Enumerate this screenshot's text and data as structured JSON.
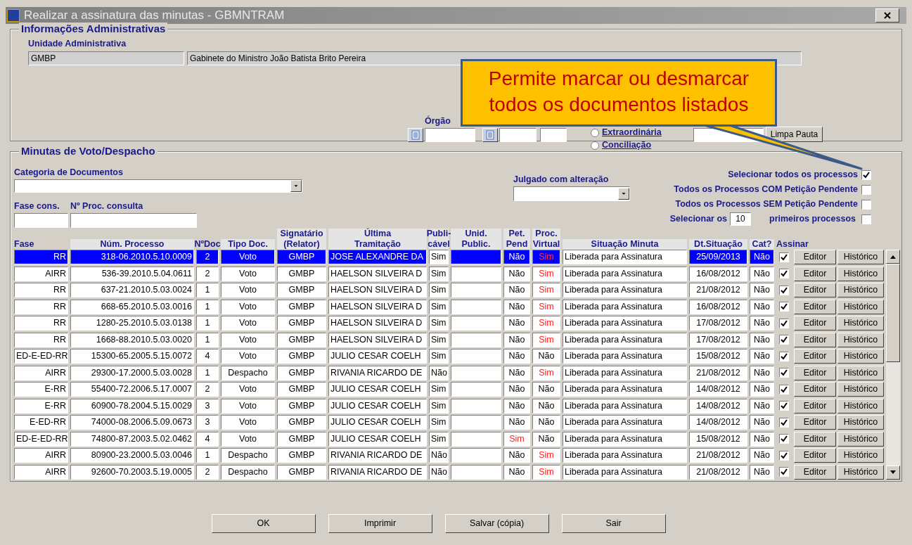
{
  "window": {
    "title": "Realizar a assinatura das minutas - GBMNTRAM"
  },
  "admin": {
    "title": "Informações Administrativas",
    "unit_label": "Unidade Administrativa",
    "unit_code": "GMBP",
    "unit_name": "Gabinete do Ministro João Batista Brito Pereira",
    "orgao_label": "Órgão",
    "sessions": [
      {
        "label": "Extraordinária",
        "selected": false
      },
      {
        "label": "Conciliação",
        "selected": false
      }
    ],
    "clear_button": "Limpa Pauta"
  },
  "minutas": {
    "title": "Minutas de Voto/Despacho",
    "category_label": "Categoria de Documentos",
    "phase_label": "Fase cons.",
    "proc_label": "Nº Proc. consulta",
    "judged_label": "Julgado com alteração",
    "options": [
      {
        "label": "Selecionar todos os processos",
        "checked": true
      },
      {
        "label": "Todos os Processos COM Petição Pendente",
        "checked": false
      },
      {
        "label": "Todos os Processos SEM Petição Pendente",
        "checked": false
      }
    ],
    "select_first": {
      "prefix": "Selecionar os",
      "value": "10",
      "suffix": "primeiros processos",
      "checked": false
    },
    "columns": [
      [
        "Fase"
      ],
      [
        "Núm. Processo"
      ],
      [
        "NºDoc"
      ],
      [
        "Tipo Doc."
      ],
      [
        "Signatário",
        "(Relator)"
      ],
      [
        "Última",
        "Tramitação"
      ],
      [
        "Publi-",
        "cável"
      ],
      [
        "Unid.",
        "Public."
      ],
      [
        "Pet.",
        "Pend"
      ],
      [
        "Proc.",
        "Virtual"
      ],
      [
        "Situação Minuta"
      ],
      [
        "Dt.Situação"
      ],
      [
        "Cat?"
      ],
      [
        "Assinar"
      ]
    ],
    "rows": [
      {
        "selected": true,
        "phase": "RR",
        "process": "318-06.2010.5.10.0009",
        "doc": "2",
        "type": "Voto",
        "signer": "GMBP",
        "last": "JOSE ALEXANDRE DA",
        "publishable": "Sim",
        "pet": {
          "text": "Não",
          "alert": false
        },
        "virtual": {
          "text": "Sim",
          "alert": true
        },
        "status": "Liberada para Assinatura",
        "date": "25/09/2013",
        "cat": "Não",
        "sign": true,
        "editor": "Editor",
        "history": "Histórico"
      },
      {
        "selected": false,
        "phase": "AIRR",
        "process": "536-39.2010.5.04.0611",
        "doc": "2",
        "type": "Voto",
        "signer": "GMBP",
        "last": "HAELSON SILVEIRA D",
        "publishable": "Sim",
        "pet": {
          "text": "Não",
          "alert": false
        },
        "virtual": {
          "text": "Sim",
          "alert": true
        },
        "status": "Liberada para Assinatura",
        "date": "16/08/2012",
        "cat": "Não",
        "sign": true,
        "editor": "Editor",
        "history": "Histórico"
      },
      {
        "selected": false,
        "phase": "RR",
        "process": "637-21.2010.5.03.0024",
        "doc": "1",
        "type": "Voto",
        "signer": "GMBP",
        "last": "HAELSON SILVEIRA D",
        "publishable": "Sim",
        "pet": {
          "text": "Não",
          "alert": false
        },
        "virtual": {
          "text": "Sim",
          "alert": true
        },
        "status": "Liberada para Assinatura",
        "date": "21/08/2012",
        "cat": "Não",
        "sign": true,
        "editor": "Editor",
        "history": "Histórico"
      },
      {
        "selected": false,
        "phase": "RR",
        "process": "668-65.2010.5.03.0016",
        "doc": "1",
        "type": "Voto",
        "signer": "GMBP",
        "last": "HAELSON SILVEIRA D",
        "publishable": "Sim",
        "pet": {
          "text": "Não",
          "alert": false
        },
        "virtual": {
          "text": "Sim",
          "alert": true
        },
        "status": "Liberada para Assinatura",
        "date": "16/08/2012",
        "cat": "Não",
        "sign": true,
        "editor": "Editor",
        "history": "Histórico"
      },
      {
        "selected": false,
        "phase": "RR",
        "process": "1280-25.2010.5.03.0138",
        "doc": "1",
        "type": "Voto",
        "signer": "GMBP",
        "last": "HAELSON SILVEIRA D",
        "publishable": "Sim",
        "pet": {
          "text": "Não",
          "alert": false
        },
        "virtual": {
          "text": "Sim",
          "alert": true
        },
        "status": "Liberada para Assinatura",
        "date": "17/08/2012",
        "cat": "Não",
        "sign": true,
        "editor": "Editor",
        "history": "Histórico"
      },
      {
        "selected": false,
        "phase": "RR",
        "process": "1668-88.2010.5.03.0020",
        "doc": "1",
        "type": "Voto",
        "signer": "GMBP",
        "last": "HAELSON SILVEIRA D",
        "publishable": "Sim",
        "pet": {
          "text": "Não",
          "alert": false
        },
        "virtual": {
          "text": "Sim",
          "alert": true
        },
        "status": "Liberada para Assinatura",
        "date": "17/08/2012",
        "cat": "Não",
        "sign": true,
        "editor": "Editor",
        "history": "Histórico"
      },
      {
        "selected": false,
        "phase": "ED-E-ED-RR",
        "process": "15300-65.2005.5.15.0072",
        "doc": "4",
        "type": "Voto",
        "signer": "GMBP",
        "last": "JULIO CESAR COELH",
        "publishable": "Sim",
        "pet": {
          "text": "Não",
          "alert": false
        },
        "virtual": {
          "text": "Não",
          "alert": false
        },
        "status": "Liberada para Assinatura",
        "date": "15/08/2012",
        "cat": "Não",
        "sign": true,
        "editor": "Editor",
        "history": "Histórico"
      },
      {
        "selected": false,
        "phase": "AIRR",
        "process": "29300-17.2000.5.03.0028",
        "doc": "1",
        "type": "Despacho",
        "signer": "GMBP",
        "last": "RIVANIA RICARDO DE",
        "publishable": "Não",
        "pet": {
          "text": "Não",
          "alert": false
        },
        "virtual": {
          "text": "Sim",
          "alert": true
        },
        "status": "Liberada para Assinatura",
        "date": "21/08/2012",
        "cat": "Não",
        "sign": true,
        "editor": "Editor",
        "history": "Histórico"
      },
      {
        "selected": false,
        "phase": "E-RR",
        "process": "55400-72.2006.5.17.0007",
        "doc": "2",
        "type": "Voto",
        "signer": "GMBP",
        "last": "JULIO CESAR COELH",
        "publishable": "Sim",
        "pet": {
          "text": "Não",
          "alert": false
        },
        "virtual": {
          "text": "Não",
          "alert": false
        },
        "status": "Liberada para Assinatura",
        "date": "14/08/2012",
        "cat": "Não",
        "sign": true,
        "editor": "Editor",
        "history": "Histórico"
      },
      {
        "selected": false,
        "phase": "E-RR",
        "process": "60900-78.2004.5.15.0029",
        "doc": "3",
        "type": "Voto",
        "signer": "GMBP",
        "last": "JULIO CESAR COELH",
        "publishable": "Sim",
        "pet": {
          "text": "Não",
          "alert": false
        },
        "virtual": {
          "text": "Não",
          "alert": false
        },
        "status": "Liberada para Assinatura",
        "date": "14/08/2012",
        "cat": "Não",
        "sign": true,
        "editor": "Editor",
        "history": "Histórico"
      },
      {
        "selected": false,
        "phase": "E-ED-RR",
        "process": "74000-08.2006.5.09.0673",
        "doc": "3",
        "type": "Voto",
        "signer": "GMBP",
        "last": "JULIO CESAR COELH",
        "publishable": "Sim",
        "pet": {
          "text": "Não",
          "alert": false
        },
        "virtual": {
          "text": "Não",
          "alert": false
        },
        "status": "Liberada para Assinatura",
        "date": "14/08/2012",
        "cat": "Não",
        "sign": true,
        "editor": "Editor",
        "history": "Histórico"
      },
      {
        "selected": false,
        "phase": "ED-E-ED-RR",
        "process": "74800-87.2003.5.02.0462",
        "doc": "4",
        "type": "Voto",
        "signer": "GMBP",
        "last": "JULIO CESAR COELH",
        "publishable": "Sim",
        "pet": {
          "text": "Sim",
          "alert": true
        },
        "virtual": {
          "text": "Não",
          "alert": false
        },
        "status": "Liberada para Assinatura",
        "date": "15/08/2012",
        "cat": "Não",
        "sign": true,
        "editor": "Editor",
        "history": "Histórico"
      },
      {
        "selected": false,
        "phase": "AIRR",
        "process": "80900-23.2000.5.03.0046",
        "doc": "1",
        "type": "Despacho",
        "signer": "GMBP",
        "last": "RIVANIA RICARDO DE",
        "publishable": "Não",
        "pet": {
          "text": "Não",
          "alert": false
        },
        "virtual": {
          "text": "Sim",
          "alert": true
        },
        "status": "Liberada para Assinatura",
        "date": "21/08/2012",
        "cat": "Não",
        "sign": true,
        "editor": "Editor",
        "history": "Histórico"
      },
      {
        "selected": false,
        "phase": "AIRR",
        "process": "92600-70.2003.5.19.0005",
        "doc": "2",
        "type": "Despacho",
        "signer": "GMBP",
        "last": "RIVANIA RICARDO DE",
        "publishable": "Não",
        "pet": {
          "text": "Não",
          "alert": false
        },
        "virtual": {
          "text": "Sim",
          "alert": true
        },
        "status": "Liberada para Assinatura",
        "date": "21/08/2012",
        "cat": "Não",
        "sign": true,
        "editor": "Editor",
        "history": "Histórico"
      }
    ]
  },
  "buttons": [
    "OK",
    "Imprimir",
    "Salvar (cópia)",
    "Sair"
  ],
  "callout": {
    "text": "Permite marcar ou desmarcar todos os documentos listados"
  }
}
